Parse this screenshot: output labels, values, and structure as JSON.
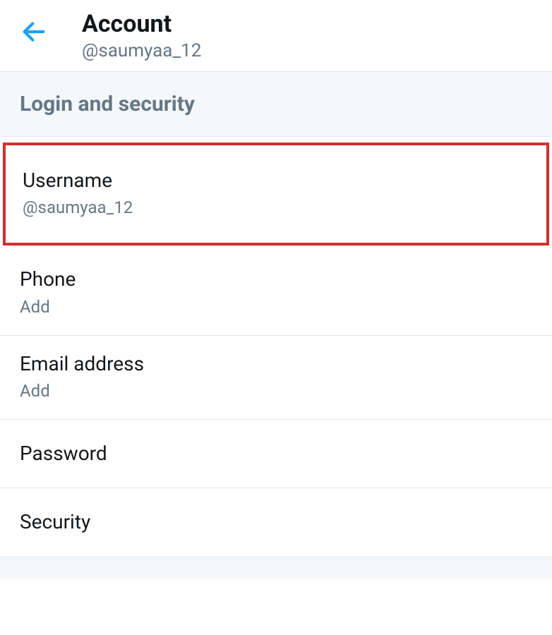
{
  "header": {
    "title": "Account",
    "subtitle": "@saumyaa_12"
  },
  "section": {
    "title": "Login and security"
  },
  "items": {
    "username": {
      "label": "Username",
      "value": "@saumyaa_12"
    },
    "phone": {
      "label": "Phone",
      "value": "Add"
    },
    "email": {
      "label": "Email address",
      "value": "Add"
    },
    "password": {
      "label": "Password"
    },
    "security": {
      "label": "Security"
    }
  }
}
